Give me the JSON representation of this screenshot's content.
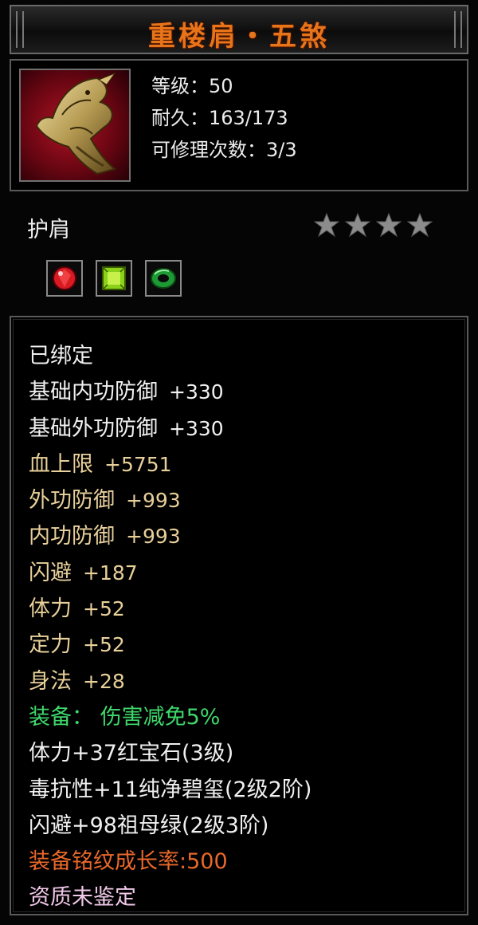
{
  "title": "重楼肩・五煞",
  "header": {
    "item_icon": "dragon-shoulder-guard-icon",
    "level": "等级：50",
    "durability": "耐久：163/173",
    "repairs": "可修理次数：3/3"
  },
  "type_label": "护肩",
  "star_count": 4,
  "gems": [
    {
      "icon": "red-gem-icon",
      "color": "#d81a22"
    },
    {
      "icon": "green-square-gem-icon",
      "color": "#8ad21a"
    },
    {
      "icon": "jade-ring-icon",
      "color": "#1e9a34"
    }
  ],
  "stats": {
    "bound": "已绑定",
    "lines": [
      {
        "label": "基础内功防御",
        "value": "+330",
        "color": "white"
      },
      {
        "label": "基础外功防御",
        "value": "+330",
        "color": "white"
      },
      {
        "label": "血上限",
        "value": "+5751",
        "color": "gold"
      },
      {
        "label": "外功防御",
        "value": "+993",
        "color": "gold"
      },
      {
        "label": "内功防御",
        "value": "+993",
        "color": "gold"
      },
      {
        "label": "闪避",
        "value": "+187",
        "color": "gold"
      },
      {
        "label": "体力",
        "value": "+52",
        "color": "gold"
      },
      {
        "label": "定力",
        "value": "+52",
        "color": "gold"
      },
      {
        "label": "身法",
        "value": "+28",
        "color": "gold"
      }
    ],
    "equip_bonus": "装备： 伤害减免5%",
    "gem_lines": [
      "体力+37红宝石(3级)",
      "毒抗性+11纯净碧玺(2级2阶)",
      "闪避+98祖母绿(2级3阶)"
    ],
    "growth": "装备铭纹成长率:500",
    "aptitude": "资质未鉴定"
  },
  "colors": {
    "title": "#e8741a",
    "gold_text": "#e8d09a",
    "green_text": "#3fd66b",
    "orange_text": "#e8682a",
    "pink_text": "#f0c8e8"
  }
}
